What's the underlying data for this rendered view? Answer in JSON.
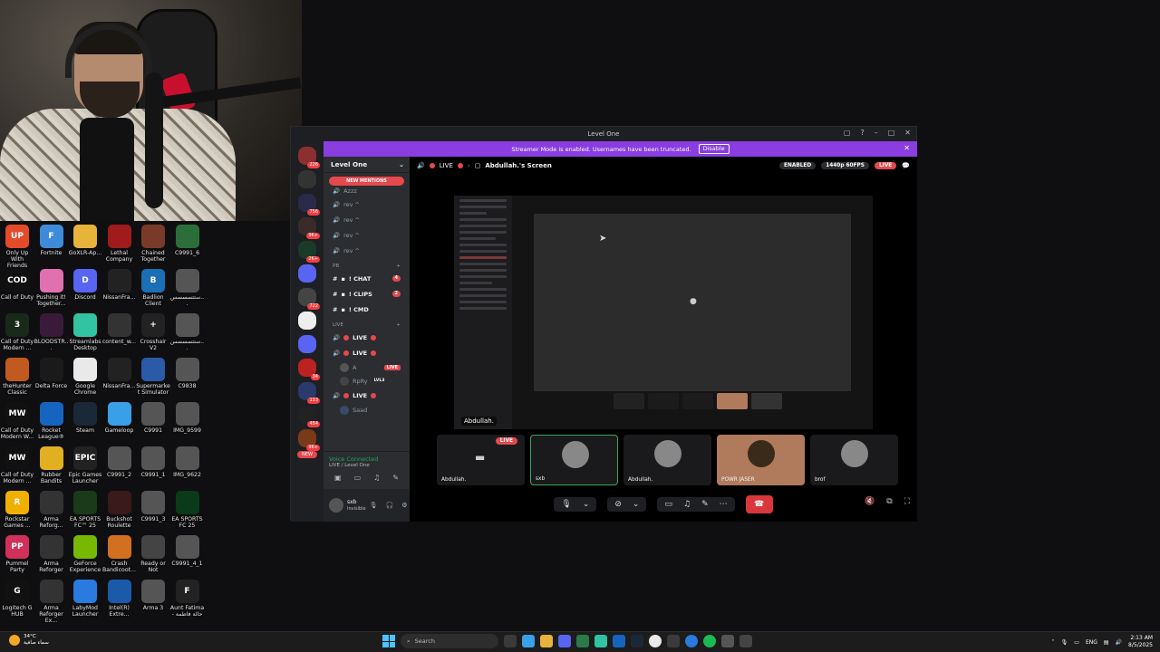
{
  "window": {
    "title": "Level One"
  },
  "streamer_bar": {
    "text": "Streamer Mode is enabled. Usernames have been truncated.",
    "disable": "Disable"
  },
  "guild_badges": [
    "226",
    "756",
    "9K+",
    "2K+",
    "722",
    "34",
    "133",
    "454",
    "9K+"
  ],
  "guild_new": "NEW",
  "server": {
    "name": "Level One",
    "new_mentions": "NEW MENTIONS",
    "top_item": "Azzz"
  },
  "channels_top": [
    {
      "label": "rev ^"
    },
    {
      "label": "rev ^"
    },
    {
      "label": "rev ^"
    },
    {
      "label": "rev ^"
    }
  ],
  "category_pb": "PB",
  "text_channels": [
    {
      "label": "! CHAT",
      "count": "4"
    },
    {
      "label": "! CLIPS",
      "count": "2"
    },
    {
      "label": "! CMD",
      "count": ""
    }
  ],
  "category_live": "LIVE",
  "live_channels": [
    {
      "label": "LIVE"
    },
    {
      "label": "LIVE"
    },
    {
      "label": "LIVE"
    }
  ],
  "live_users": [
    {
      "name": "A",
      "tag": "LIVE"
    },
    {
      "name": "RpRy",
      "tag": "LVL3"
    },
    {
      "name": "Saad",
      "tag": ""
    }
  ],
  "voice": {
    "status": "Voice Connected",
    "location": "LIVE / Level One"
  },
  "user": {
    "name": "sxb",
    "status": "Invisible"
  },
  "stage": {
    "channel": "LIVE",
    "screen_title": "Abdullah.'s Screen",
    "enabled": "ENABLED",
    "quality": "1440p 60FPS",
    "live": "LIVE",
    "screen_owner": "Abdullah."
  },
  "tiles": [
    {
      "name": "Abdullah.",
      "live": "LIVE",
      "color": "#1a1a1c"
    },
    {
      "name": "sxb",
      "live": "",
      "color": "#2a2a2a"
    },
    {
      "name": "Abdullah.",
      "live": "",
      "color": "#1f1f1f"
    },
    {
      "name": "POWR JASER",
      "live": "",
      "color": "#b07a5c"
    },
    {
      "name": "brof",
      "live": "",
      "color": "#1f1f1f"
    }
  ],
  "desktop_icons": [
    {
      "label": "Only Up With Friends",
      "color": "#e34b2a",
      "glyph": "UP"
    },
    {
      "label": "Fortnite",
      "color": "#3d8bd9",
      "glyph": "F"
    },
    {
      "label": "GoXLR-Ap...",
      "color": "#e8b33a",
      "glyph": ""
    },
    {
      "label": "Lethal Company",
      "color": "#a01b1b",
      "glyph": ""
    },
    {
      "label": "Chained Together",
      "color": "#7a3a2a",
      "glyph": ""
    },
    {
      "label": "C9991_6",
      "color": "#2c6e3a",
      "glyph": ""
    },
    {
      "label": "Call of Duty",
      "color": "#111111",
      "glyph": "COD"
    },
    {
      "label": "Pushing it! Together...",
      "color": "#e070b0",
      "glyph": ""
    },
    {
      "label": "Discord",
      "color": "#5865f2",
      "glyph": "D"
    },
    {
      "label": "NissanFra...",
      "color": "#222222",
      "glyph": ""
    },
    {
      "label": "Badlion Client",
      "color": "#1b6fb5",
      "glyph": "B"
    },
    {
      "label": "ستتسسسس...",
      "color": "#555555",
      "glyph": ""
    },
    {
      "label": "Call of Duty Modern ...",
      "color": "#1a2a1a",
      "glyph": "3"
    },
    {
      "label": "BLOODSTR...",
      "color": "#3a1a3a",
      "glyph": ""
    },
    {
      "label": "Streamlabs Desktop",
      "color": "#31c3a2",
      "glyph": ""
    },
    {
      "label": "content_w...",
      "color": "#333333",
      "glyph": ""
    },
    {
      "label": "Crosshair V2",
      "color": "#222222",
      "glyph": "+"
    },
    {
      "label": "ستتسسسس...",
      "color": "#555555",
      "glyph": ""
    },
    {
      "label": "theHunter Classic",
      "color": "#c05a20",
      "glyph": ""
    },
    {
      "label": "Delta Force",
      "color": "#1a1a1a",
      "glyph": ""
    },
    {
      "label": "Google Chrome",
      "color": "#e9e9e9",
      "glyph": ""
    },
    {
      "label": "NissanFra...",
      "color": "#222222",
      "glyph": ""
    },
    {
      "label": "Supermarket Simulator",
      "color": "#2a5aa8",
      "glyph": ""
    },
    {
      "label": "C9838",
      "color": "#555555",
      "glyph": ""
    },
    {
      "label": "Call of Duty Modern W...",
      "color": "#111111",
      "glyph": "MW"
    },
    {
      "label": "Rocket League®",
      "color": "#1565c0",
      "glyph": ""
    },
    {
      "label": "Steam",
      "color": "#1b2838",
      "glyph": ""
    },
    {
      "label": "Gameloop",
      "color": "#39a0e8",
      "glyph": ""
    },
    {
      "label": "C9991",
      "color": "#555555",
      "glyph": ""
    },
    {
      "label": "IMG_9599",
      "color": "#555555",
      "glyph": ""
    },
    {
      "label": "Call of Duty Modern ...",
      "color": "#111111",
      "glyph": "MW"
    },
    {
      "label": "Rubber Bandits",
      "color": "#e0b020",
      "glyph": ""
    },
    {
      "label": "Epic Games Launcher",
      "color": "#222222",
      "glyph": "EPIC"
    },
    {
      "label": "C9991_2",
      "color": "#555555",
      "glyph": ""
    },
    {
      "label": "C9991_1",
      "color": "#555555",
      "glyph": ""
    },
    {
      "label": "IMG_9622",
      "color": "#555555",
      "glyph": ""
    },
    {
      "label": "Rockstar Games ...",
      "color": "#f0b000",
      "glyph": "R"
    },
    {
      "label": "Arma Reforg...",
      "color": "#333333",
      "glyph": ""
    },
    {
      "label": "EA SPORTS FC™ 25",
      "color": "#1a3a1a",
      "glyph": ""
    },
    {
      "label": "Buckshot Roulette",
      "color": "#3a1a1a",
      "glyph": ""
    },
    {
      "label": "C9991_3",
      "color": "#555555",
      "glyph": ""
    },
    {
      "label": "EA SPORTS FC 25",
      "color": "#0a3a1a",
      "glyph": ""
    },
    {
      "label": "Pummel Party",
      "color": "#d0305a",
      "glyph": "PP"
    },
    {
      "label": "Arma Reforger",
      "color": "#333333",
      "glyph": ""
    },
    {
      "label": "GeForce Experience",
      "color": "#76b900",
      "glyph": ""
    },
    {
      "label": "Crash Bandicoot...",
      "color": "#d07020",
      "glyph": ""
    },
    {
      "label": "Ready or Not",
      "color": "#444444",
      "glyph": ""
    },
    {
      "label": "C9991_4_1",
      "color": "#555555",
      "glyph": ""
    },
    {
      "label": "Logitech G HUB",
      "color": "#111111",
      "glyph": "G"
    },
    {
      "label": "Arma Reforger Ex...",
      "color": "#333333",
      "glyph": ""
    },
    {
      "label": "LabyMod Launcher",
      "color": "#2a7ae0",
      "glyph": ""
    },
    {
      "label": "Intel(R) Extre...",
      "color": "#1a5aa8",
      "glyph": ""
    },
    {
      "label": "Arma 3",
      "color": "#555555",
      "glyph": ""
    },
    {
      "label": "Aunt Fatima - حالة فاطمة",
      "color": "#222222",
      "glyph": "F"
    }
  ],
  "taskbar": {
    "weather_temp": "34°C",
    "weather_desc": "سماء صافية",
    "search_placeholder": "Search",
    "lang": "ENG",
    "time": "2:13 AM",
    "date": "8/5/2025"
  }
}
